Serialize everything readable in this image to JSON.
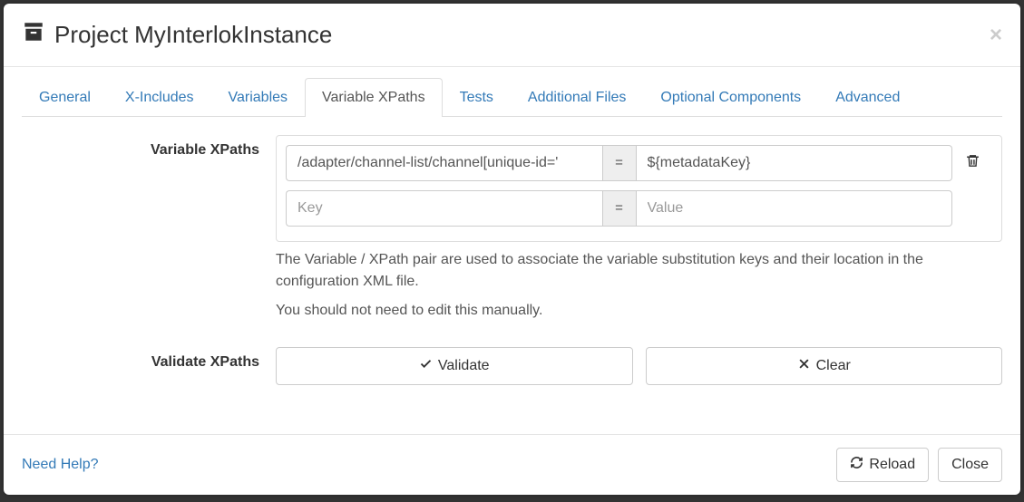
{
  "header": {
    "title": "Project MyInterlokInstance"
  },
  "tabs": [
    {
      "label": "General",
      "active": false
    },
    {
      "label": "X-Includes",
      "active": false
    },
    {
      "label": "Variables",
      "active": false
    },
    {
      "label": "Variable XPaths",
      "active": true
    },
    {
      "label": "Tests",
      "active": false
    },
    {
      "label": "Additional Files",
      "active": false
    },
    {
      "label": "Optional Components",
      "active": false
    },
    {
      "label": "Advanced",
      "active": false
    }
  ],
  "form": {
    "variableXPaths": {
      "label": "Variable XPaths",
      "rows": [
        {
          "key": "/adapter/channel-list/channel[unique-id='",
          "value": "${metadataKey}"
        }
      ],
      "emptyRow": {
        "keyPlaceholder": "Key",
        "valuePlaceholder": "Value",
        "separator": "="
      },
      "separator": "=",
      "help1": "The Variable / XPath pair are used to associate the variable substitution keys and their location in the configuration XML file.",
      "help2": "You should not need to edit this manually."
    },
    "validateXPaths": {
      "label": "Validate XPaths",
      "validateBtn": "Validate",
      "clearBtn": "Clear"
    }
  },
  "footer": {
    "helpLink": "Need Help?",
    "reloadBtn": "Reload",
    "closeBtn": "Close"
  }
}
